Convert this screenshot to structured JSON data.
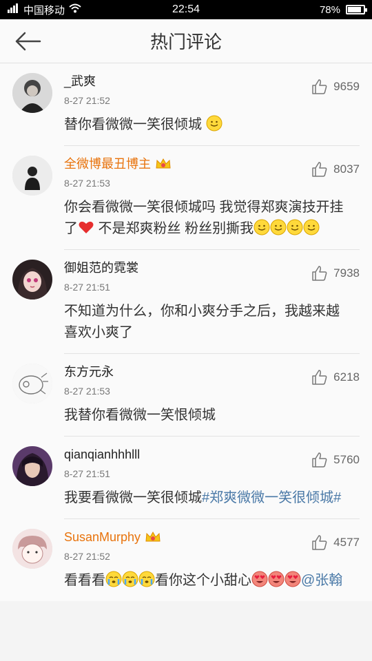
{
  "status": {
    "signal": "4G",
    "carrier": "中国移动",
    "time": "22:54",
    "battery_text": "78%",
    "battery_level": 0.78
  },
  "header": {
    "title": "热门评论"
  },
  "comments": [
    {
      "name": "_武爽",
      "time": "8-27 21:52",
      "likes": "9659",
      "text_a": "替你看微微一笑很倾城"
    },
    {
      "name": "全微博最丑博主",
      "time": "8-27 21:53",
      "likes": "8037",
      "text_a": "你会看微微一笑很倾城吗   我觉得郑爽演技开挂了",
      "text_b": "    不是郑爽粉丝     粉丝别撕我"
    },
    {
      "name": "御姐范的霓裳",
      "time": "8-27 21:51",
      "likes": "7938",
      "text_a": "不知道为什么，你和小爽分手之后，我越来越喜欢小爽了"
    },
    {
      "name": "东方元永",
      "time": "8-27 21:53",
      "likes": "6218",
      "text_a": "我替你看微微一笑恨倾城"
    },
    {
      "name": "qianqianhhhlll",
      "time": "8-27 21:51",
      "likes": "5760",
      "text_a": "我要看微微一笑很倾城",
      "tag": "#郑爽微微一笑很倾城#"
    },
    {
      "name": "SusanMurphy",
      "time": "8-27 21:52",
      "likes": "4577",
      "text_a": "看看看",
      "text_b": "看你这个小甜心",
      "mention": "@张翰"
    }
  ],
  "icons": {
    "back": "arrow-left-icon",
    "like": "thumbs-up-icon",
    "vip": "crown-badge-icon"
  },
  "colors": {
    "vip_name": "#e8730c",
    "link": "#4a79a7"
  }
}
